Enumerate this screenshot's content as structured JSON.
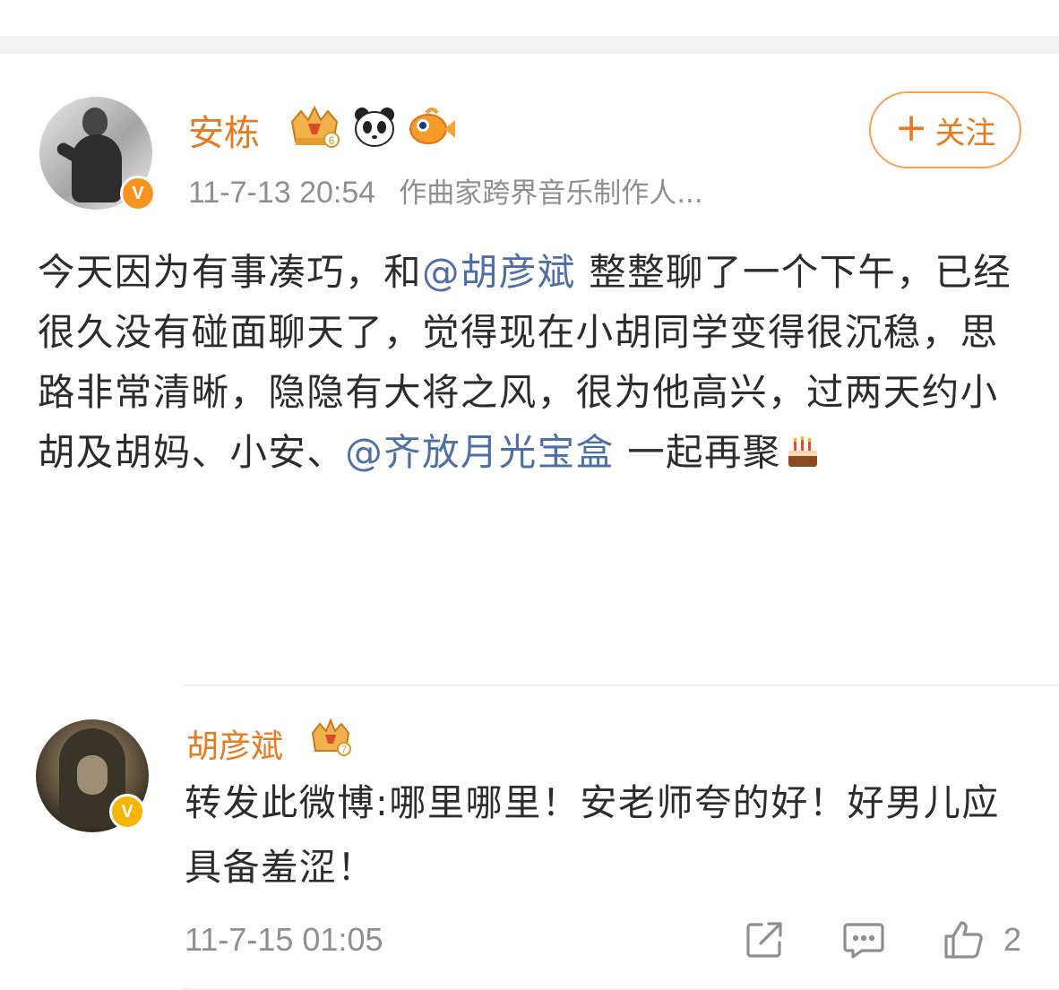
{
  "post": {
    "author": "安栋",
    "time": "11-7-13 20:54",
    "source": "作曲家跨界音乐制作人...",
    "follow_label": "关注",
    "follow_plus": "+",
    "verified_mark": "V",
    "text_parts": [
      "今天因为有事凑巧，和",
      "@胡彦斌",
      " 整整聊了一个下午，已经很久没有碰面聊天了，觉得现在小胡同学变得很沉稳，思路非常清晰，隐隐有大将之风，很为他高兴，过两天约小胡及胡妈、小安、",
      "@齐放月光宝盒",
      " 一起再聚"
    ],
    "badges": [
      "crown-level-6-icon",
      "panda-icon",
      "fish-icon"
    ],
    "badge_crown_level": "6",
    "emoji": "cake-icon"
  },
  "comment": {
    "author": "胡彦斌",
    "badge_level": "7",
    "verified_mark": "V",
    "text": "转发此微博:哪里哪里！安老师夸的好！好男儿应具备羞涩！",
    "time": "11-7-15 01:05",
    "like_count": "2"
  },
  "colors": {
    "accent_orange": "#ea7a1d",
    "mention_blue": "#4d6fa7",
    "meta_gray": "#8f8f8f"
  }
}
